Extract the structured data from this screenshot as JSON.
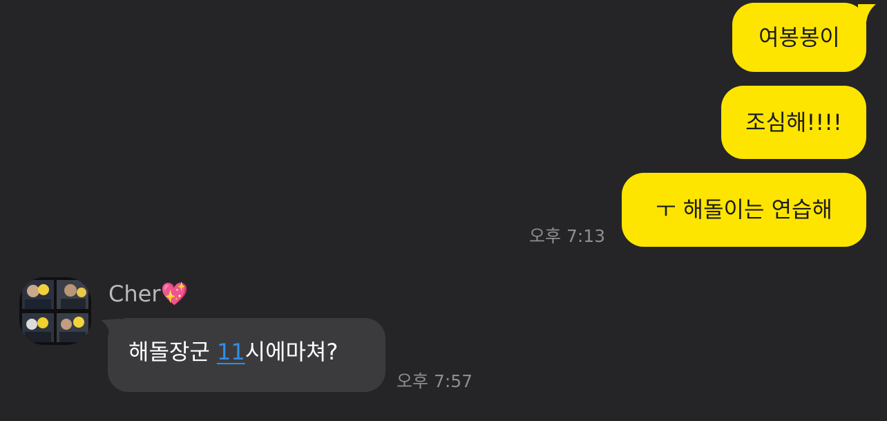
{
  "messages": {
    "outgoing": [
      {
        "text": "여봉봉이"
      },
      {
        "text": "조심해!!!!"
      },
      {
        "text": "ㅜ 해돌이는 연습해"
      }
    ],
    "outgoing_time": "오후 7:13",
    "incoming": {
      "sender_name": "Cher💖",
      "text_before": "해돌장군 ",
      "link_text": "11",
      "text_after": "시에마쳐?",
      "time": "오후 7:57"
    }
  },
  "colors": {
    "background": "#252527",
    "outgoing_bubble": "#FEE500",
    "incoming_bubble": "#3b3b3e",
    "link": "#2f8fe6",
    "time_text": "#8e8e90"
  }
}
